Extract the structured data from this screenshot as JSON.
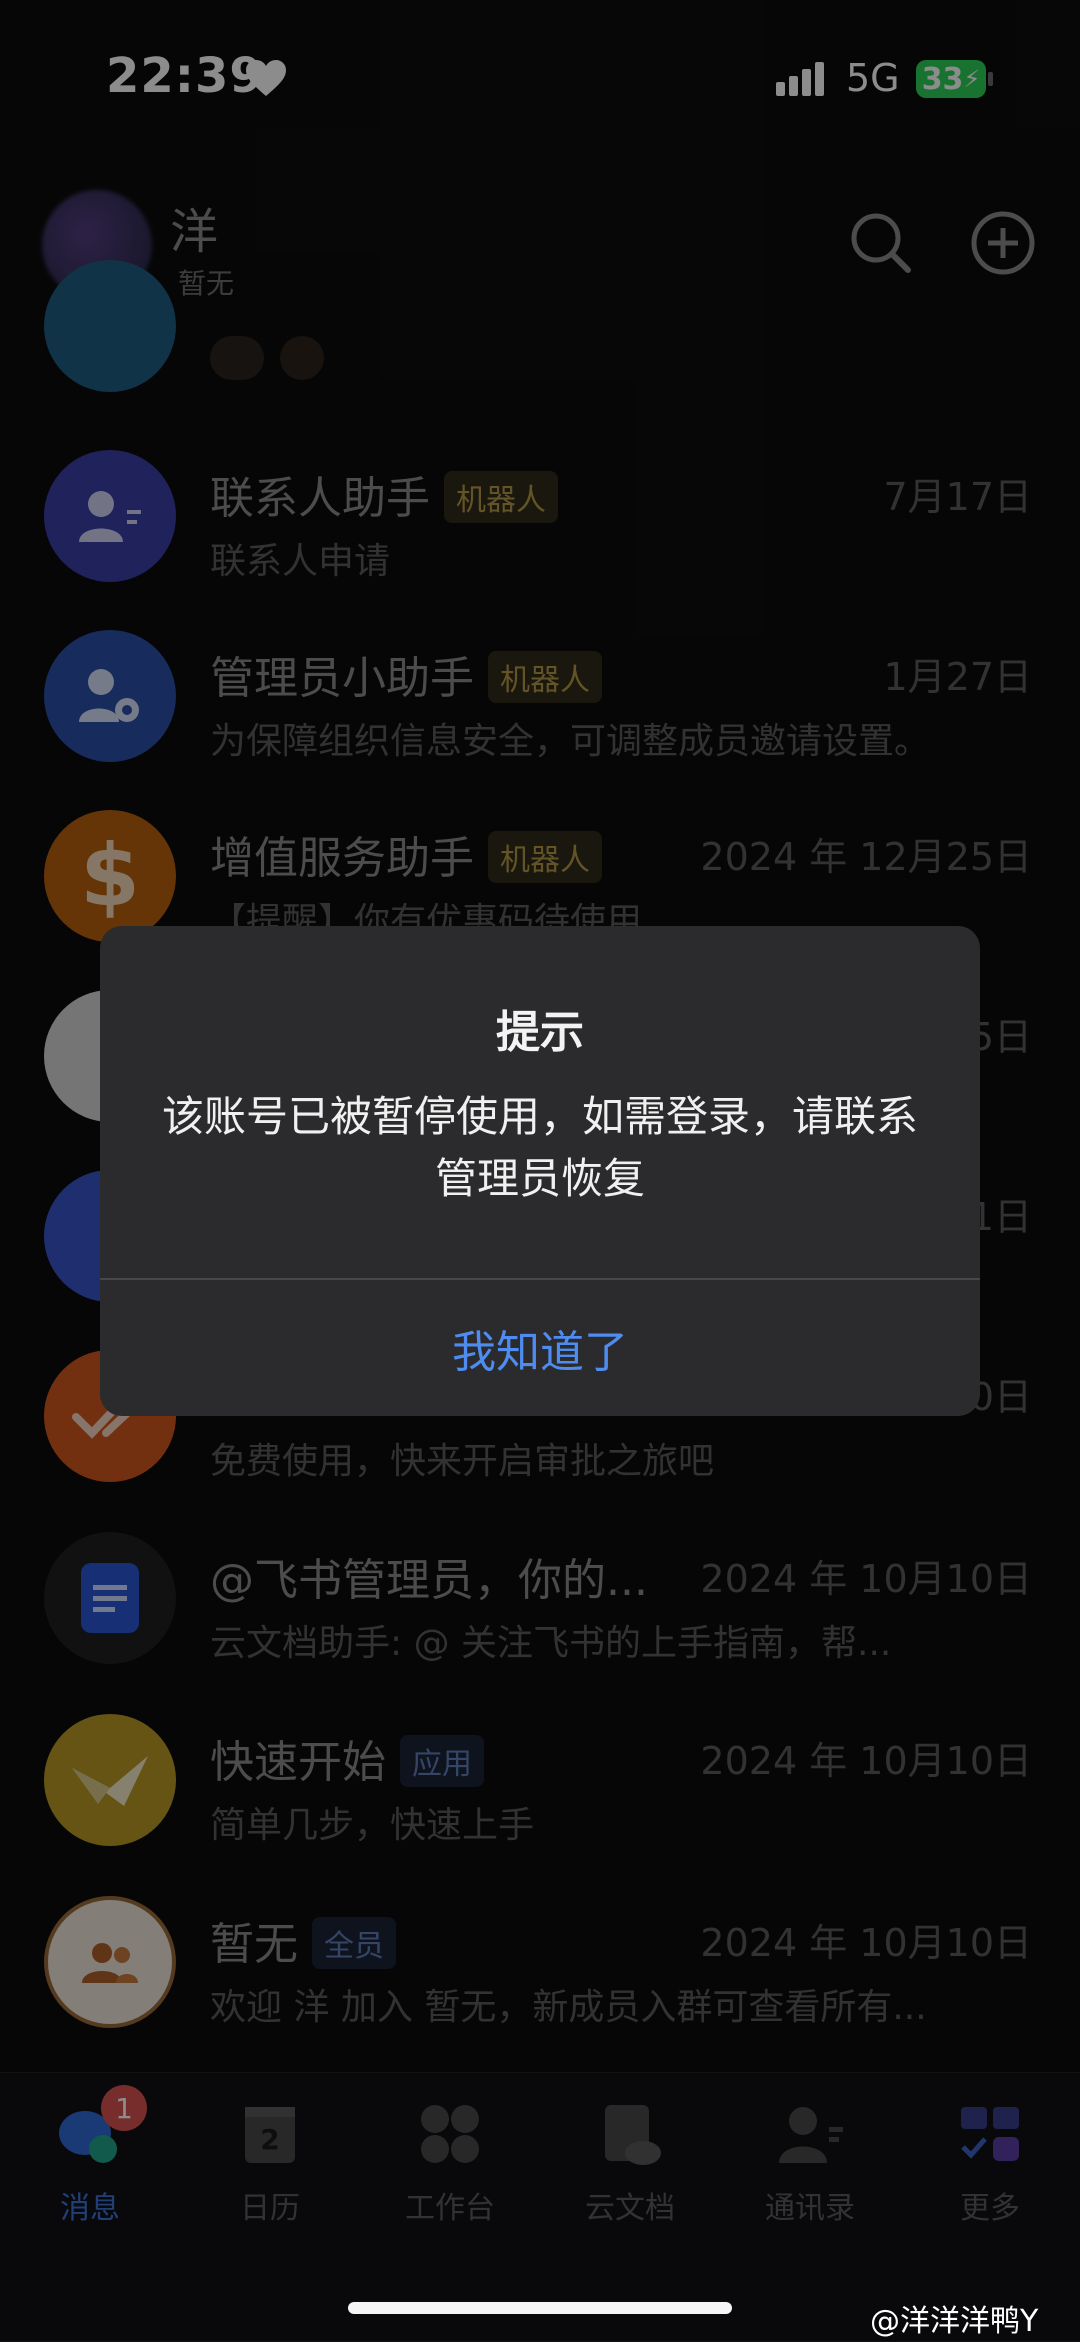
{
  "status_bar": {
    "time": "22:39",
    "network": "5G",
    "battery": "33"
  },
  "header": {
    "name": "洋",
    "subtitle": "暂无"
  },
  "rows": [
    {
      "title": "联系人助手",
      "tag": "机器人",
      "date": "7月17日",
      "subtitle": "联系人申请"
    },
    {
      "title": "管理员小助手",
      "tag": "机器人",
      "date": "1月27日",
      "subtitle": "为保障组织信息安全，可调整成员邀请设置。"
    },
    {
      "title": "增值服务助手",
      "tag": "机器人",
      "date": "2024 年 12月25日",
      "subtitle": "【提醒】你有优惠码待使用"
    },
    {
      "date": "5日"
    },
    {
      "date": "1日"
    },
    {
      "date": "0日",
      "subtitle": "免费使用，快来开启审批之旅吧"
    },
    {
      "title": "@飞书管理员，你的...",
      "date": "2024 年 10月10日",
      "subtitle": "云文档助手: @ 关注飞书的上手指南，帮..."
    },
    {
      "title": "快速开始",
      "tag": "应用",
      "date": "2024 年 10月10日",
      "subtitle": "简单几步，快速上手"
    },
    {
      "title": "暂无",
      "tag": "全员",
      "date": "2024 年 10月10日",
      "subtitle": "欢迎 洋 加入 暂无，新成员入群可查看所有..."
    }
  ],
  "dialog": {
    "title": "提示",
    "message": "该账号已被暂停使用，如需登录，请联系管理员恢复",
    "button": "我知道了"
  },
  "tabbar": {
    "items": [
      {
        "label": "消息",
        "badge": "1"
      },
      {
        "label": "日历",
        "icon_text": "2"
      },
      {
        "label": "工作台"
      },
      {
        "label": "云文档"
      },
      {
        "label": "通讯录"
      },
      {
        "label": "更多"
      }
    ]
  },
  "watermark": "@洋洋洋鸭Y",
  "colors": {
    "accent": "#4f8cf0",
    "bot_tag": "#b59a44",
    "app_tag": "#5f7fb8"
  }
}
